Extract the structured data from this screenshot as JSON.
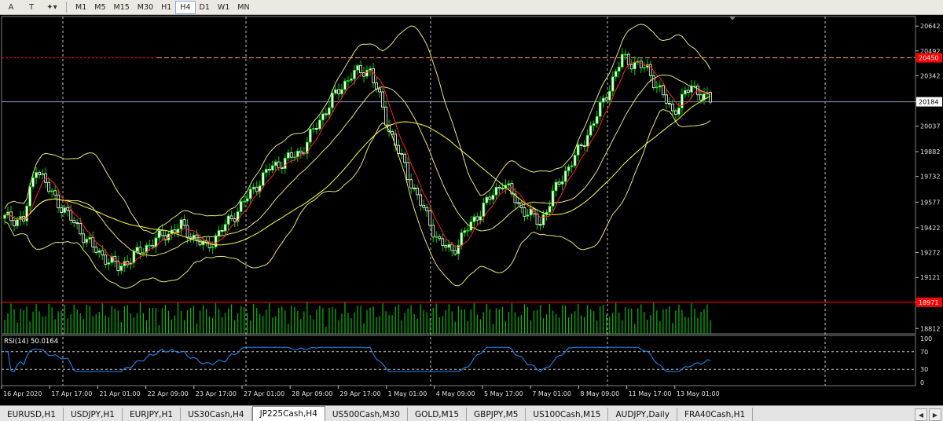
{
  "toolbar": {
    "tools": [
      {
        "name": "text-tool-icon",
        "glyph": "A"
      },
      {
        "name": "text-label-tool-icon",
        "glyph": "T"
      },
      {
        "name": "arrows-tool-icon",
        "glyph": "✦▾"
      }
    ],
    "timeframes": [
      "M1",
      "M5",
      "M15",
      "M30",
      "H1",
      "H4",
      "D1",
      "W1",
      "MN"
    ],
    "active_timeframe": "H4"
  },
  "chart": {
    "background": "#000000",
    "price_scale": [
      "20642",
      "20492",
      "20342",
      "20184",
      "20037",
      "19882",
      "19732",
      "19577",
      "19422",
      "19272",
      "19121",
      "18971",
      "18812"
    ],
    "current_price_label": "20184",
    "top_level_label": "20450",
    "bottom_level_label": "18971",
    "level_color": "#ff0000",
    "indicator_label": "RSI(14) 50.0164",
    "rsi_scale": [
      "100",
      "70",
      "30",
      "0"
    ],
    "dates": [
      "16 Apr 2020",
      "17 Apr 17:00",
      "21 Apr 01:00",
      "22 Apr 09:00",
      "23 Apr 17:00",
      "27 Apr 01:00",
      "28 Apr 09:00",
      "29 Apr 17:00",
      "1 May 01:00",
      "4 May 09:00",
      "5 May 17:00",
      "7 May 01:00",
      "8 May 09:00",
      "11 May 17:00",
      "13 May 01:00"
    ],
    "bull_color": "#ffffff",
    "bear_color": "#ffffff",
    "band_color": "#e6e67a",
    "ma_fast_color": "#ff2020",
    "ma_slow_color": "#ffff40",
    "rsi_color": "#1e90ff",
    "volume_color": "#00c000"
  },
  "tabs": [
    "EURUSD,H1",
    "USDJPY,H1",
    "EURJPY,H1",
    "US30Cash,H4",
    "JP225Cash,H4",
    "US500Cash,M30",
    "GOLD,M15",
    "GBPJPY,M5",
    "US100Cash,M15",
    "AUDJPY,Daily",
    "FRA40Cash,H1"
  ],
  "active_tab": "JP225Cash,H4"
}
